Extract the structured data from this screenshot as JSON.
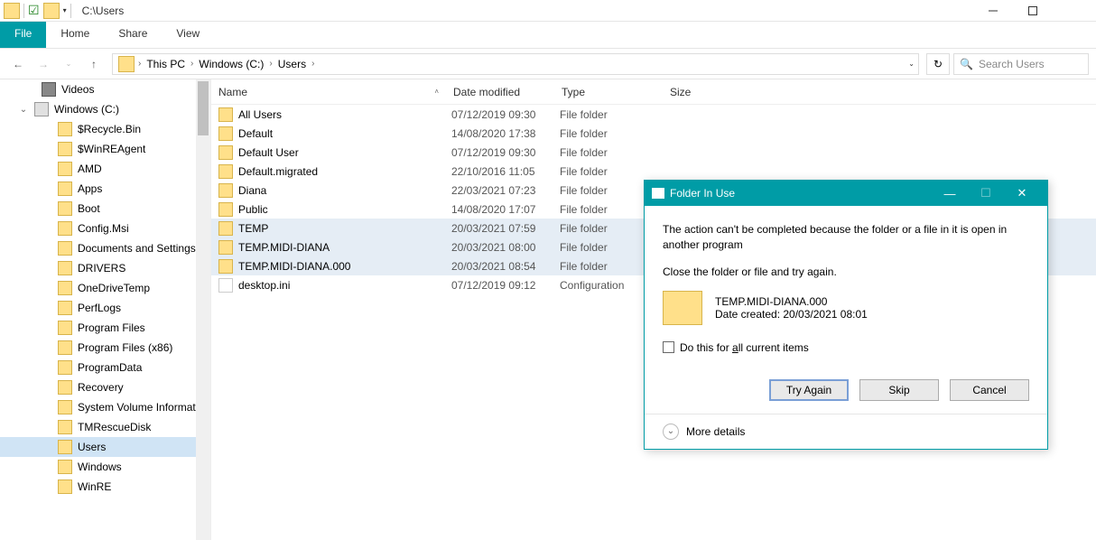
{
  "titlebar": {
    "path": "C:\\Users"
  },
  "ribbon": {
    "file": "File",
    "home": "Home",
    "share": "Share",
    "view": "View"
  },
  "breadcrumb": {
    "root_chev": "›",
    "pc": "This PC",
    "drive": "Windows (C:)",
    "folder": "Users"
  },
  "search": {
    "placeholder": "Search Users"
  },
  "tree": {
    "videos": "Videos",
    "drive": "Windows (C:)",
    "items": [
      "$Recycle.Bin",
      "$WinREAgent",
      "AMD",
      "Apps",
      "Boot",
      "Config.Msi",
      "Documents and Settings",
      "DRIVERS",
      "OneDriveTemp",
      "PerfLogs",
      "Program Files",
      "Program Files (x86)",
      "ProgramData",
      "Recovery",
      "System Volume Information",
      "TMRescueDisk",
      "Users",
      "Windows",
      "WinRE"
    ]
  },
  "headers": {
    "name": "Name",
    "date": "Date modified",
    "type": "Type",
    "size": "Size"
  },
  "files": [
    {
      "name": "All Users",
      "date": "07/12/2019 09:30",
      "type": "File folder",
      "icon": "folder",
      "sel": false
    },
    {
      "name": "Default",
      "date": "14/08/2020 17:38",
      "type": "File folder",
      "icon": "folder",
      "sel": false
    },
    {
      "name": "Default User",
      "date": "07/12/2019 09:30",
      "type": "File folder",
      "icon": "folder",
      "sel": false
    },
    {
      "name": "Default.migrated",
      "date": "22/10/2016 11:05",
      "type": "File folder",
      "icon": "folder",
      "sel": false
    },
    {
      "name": "Diana",
      "date": "22/03/2021 07:23",
      "type": "File folder",
      "icon": "folder",
      "sel": false
    },
    {
      "name": "Public",
      "date": "14/08/2020 17:07",
      "type": "File folder",
      "icon": "folder",
      "sel": false
    },
    {
      "name": "TEMP",
      "date": "20/03/2021 07:59",
      "type": "File folder",
      "icon": "folder",
      "sel": true
    },
    {
      "name": "TEMP.MIDI-DIANA",
      "date": "20/03/2021 08:00",
      "type": "File folder",
      "icon": "folder",
      "sel": true
    },
    {
      "name": "TEMP.MIDI-DIANA.000",
      "date": "20/03/2021 08:54",
      "type": "File folder",
      "icon": "folder",
      "sel": true
    },
    {
      "name": "desktop.ini",
      "date": "07/12/2019 09:12",
      "type": "Configuration",
      "icon": "ini",
      "sel": false
    }
  ],
  "dialog": {
    "title": "Folder In Use",
    "msg": "The action can't be completed because the folder or a file in it is open in another program",
    "sub": "Close the folder or file and try again.",
    "item_name": "TEMP.MIDI-DIANA.000",
    "item_date_label": "Date created: 20/03/2021 08:01",
    "checkbox_label": "Do this for all current items",
    "try_again": "Try Again",
    "skip": "Skip",
    "cancel": "Cancel",
    "more": "More details"
  }
}
